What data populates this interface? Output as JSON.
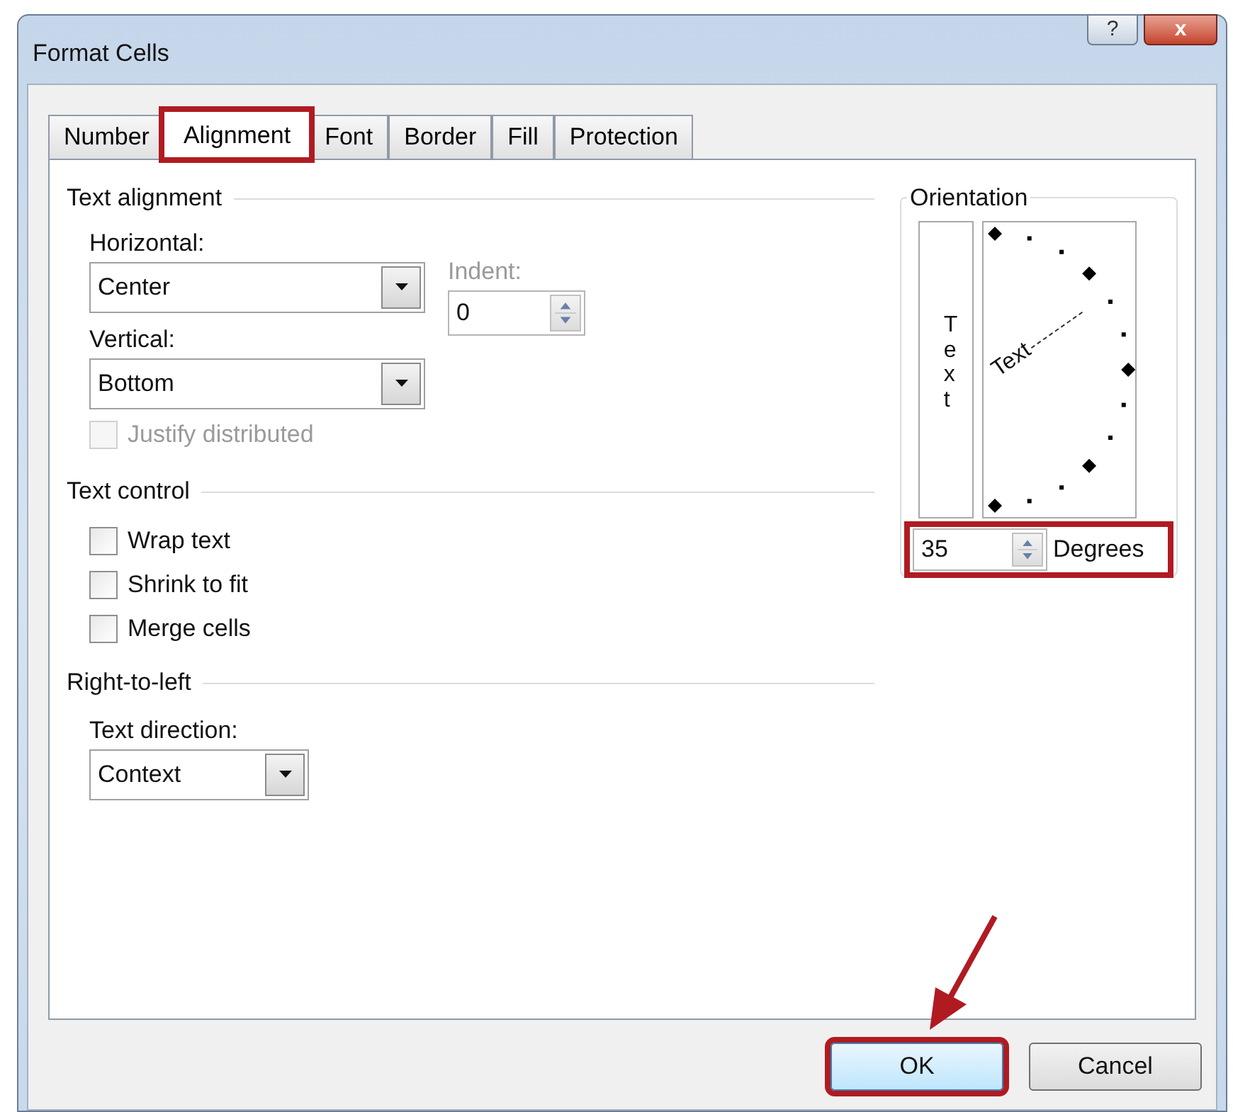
{
  "window": {
    "title": "Format Cells",
    "help_glyph": "?",
    "close_glyph": "x"
  },
  "tabs": [
    {
      "label": "Number",
      "selected": false,
      "highlighted": false
    },
    {
      "label": "Alignment",
      "selected": true,
      "highlighted": true
    },
    {
      "label": "Font",
      "selected": false,
      "highlighted": false
    },
    {
      "label": "Border",
      "selected": false,
      "highlighted": false
    },
    {
      "label": "Fill",
      "selected": false,
      "highlighted": false
    },
    {
      "label": "Protection",
      "selected": false,
      "highlighted": false
    }
  ],
  "text_alignment": {
    "heading": "Text alignment",
    "horizontal": {
      "label": "Horizontal:",
      "value": "Center"
    },
    "indent": {
      "label": "Indent:",
      "value": "0",
      "disabled": true
    },
    "vertical": {
      "label": "Vertical:",
      "value": "Bottom"
    },
    "justify_distributed": {
      "label": "Justify distributed",
      "checked": false,
      "disabled": true
    }
  },
  "text_control": {
    "heading": "Text control",
    "options": [
      {
        "label": "Wrap text",
        "checked": false
      },
      {
        "label": "Shrink to fit",
        "checked": false
      },
      {
        "label": "Merge cells",
        "checked": false
      }
    ]
  },
  "right_to_left": {
    "heading": "Right-to-left",
    "direction": {
      "label": "Text direction:",
      "value": "Context"
    }
  },
  "orientation": {
    "heading": "Orientation",
    "vertical_text": "Text",
    "dial_text": "Text",
    "degrees": {
      "value": "35",
      "label": "Degrees",
      "highlighted": true
    }
  },
  "buttons": [
    {
      "label": "OK",
      "highlighted": true
    },
    {
      "label": "Cancel",
      "highlighted": false
    }
  ],
  "annotation_arrow": true
}
